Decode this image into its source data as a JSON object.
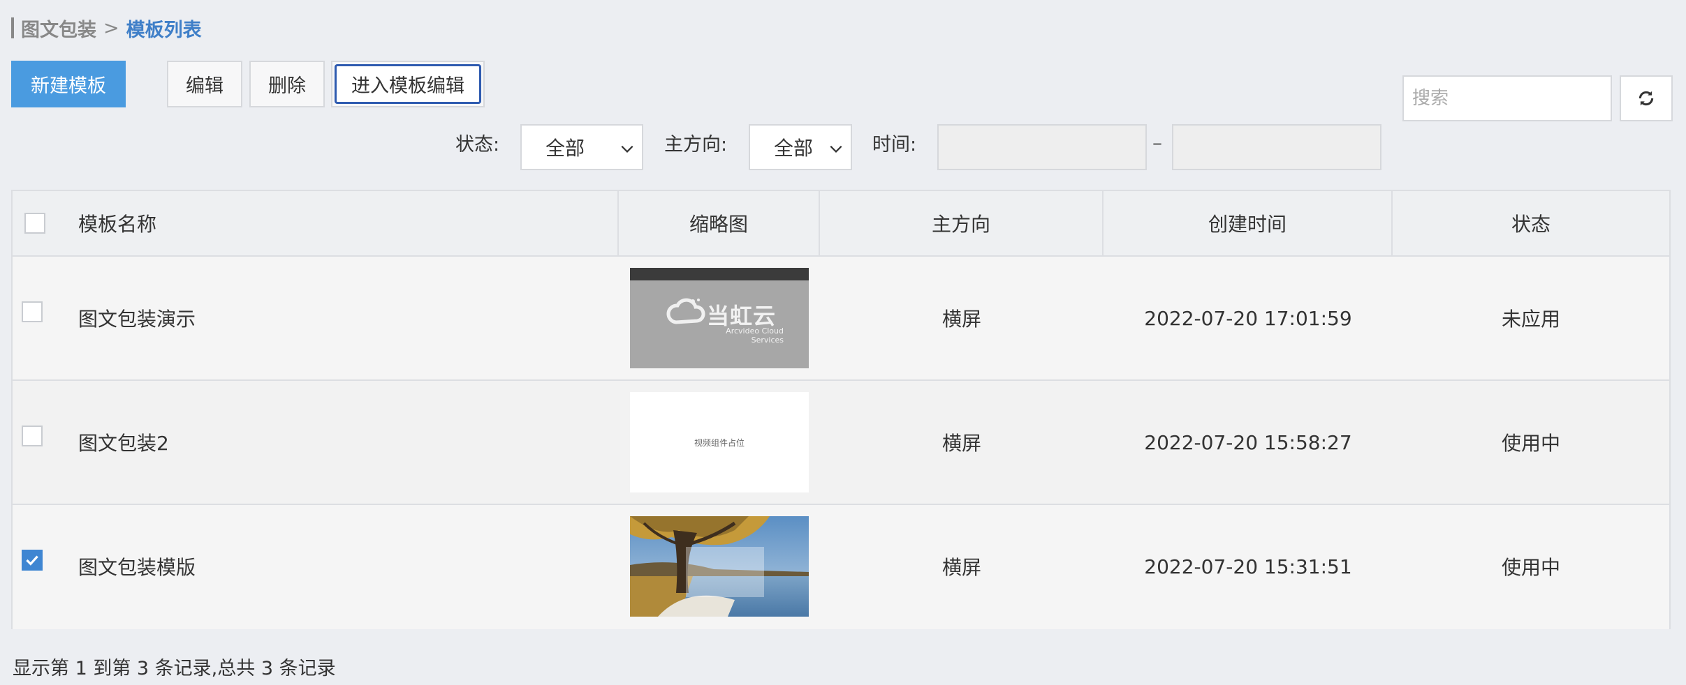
{
  "breadcrumb": {
    "parent": "图文包装",
    "separator": ">",
    "current": "模板列表"
  },
  "toolbar": {
    "new_label": "新建模板",
    "edit_label": "编辑",
    "delete_label": "删除",
    "enter_editor_label": "进入模板编辑"
  },
  "search": {
    "placeholder": "搜索",
    "value": "",
    "refresh_icon": "refresh-icon"
  },
  "filters": {
    "status_label": "状态:",
    "status_value": "全部",
    "direction_label": "主方向:",
    "direction_value": "全部",
    "time_label": "时间:",
    "time_start": "",
    "time_sep": "–",
    "time_end": ""
  },
  "table": {
    "columns": [
      "模板名称",
      "缩略图",
      "主方向",
      "创建时间",
      "状态"
    ],
    "rows": [
      {
        "name": "图文包装演示",
        "thumbnail": "logo",
        "thumb_logo_text": "当虹云",
        "thumb_logo_sub": "Arcvideo Cloud Services",
        "direction": "横屏",
        "created": "2022-07-20 17:01:59",
        "status": "未应用",
        "checked": false
      },
      {
        "name": "图文包装2",
        "thumbnail": "placeholder",
        "thumb_text": "视频组件占位",
        "direction": "横屏",
        "created": "2022-07-20 15:58:27",
        "status": "使用中",
        "checked": false
      },
      {
        "name": "图文包装模版",
        "thumbnail": "landscape",
        "direction": "横屏",
        "created": "2022-07-20 15:31:51",
        "status": "使用中",
        "checked": true
      }
    ]
  },
  "footer": {
    "summary": "显示第 1 到第 3 条记录,总共 3 条记录"
  },
  "colors": {
    "primary": "#4a9be0",
    "breadcrumb_current": "#3f7fc8",
    "focus_border": "#2f5bb0",
    "checkbox_checked": "#3f86d2"
  }
}
